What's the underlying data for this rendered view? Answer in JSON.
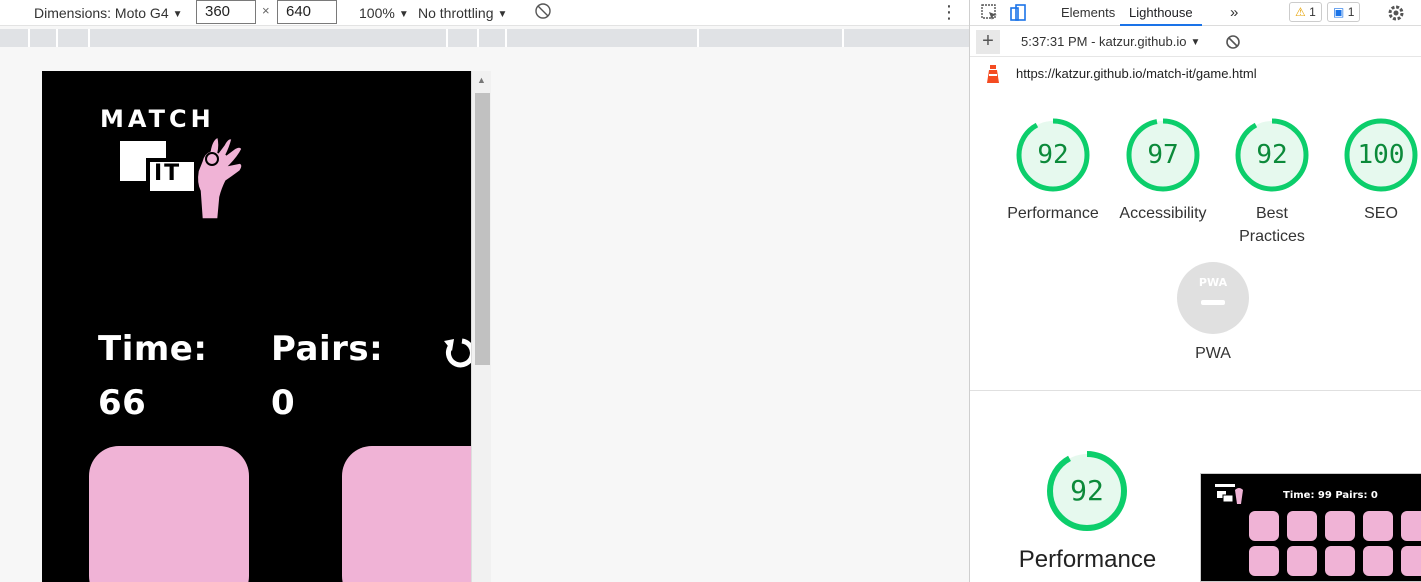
{
  "device_toolbar": {
    "dimensions_label": "Dimensions: Moto G4",
    "width_value": "360",
    "times_symbol": "×",
    "height_value": "640",
    "zoom_label": "100%",
    "throttling_label": "No throttling",
    "more_icon": "kebab-icon",
    "rotate_icon": "rotate-icon"
  },
  "game": {
    "logo_word_match": "MATCH",
    "logo_word_it": "IT",
    "time_label": "Time:",
    "time_value": "66",
    "pairs_label": "Pairs:",
    "pairs_value": "0",
    "restart_icon": "restart-icon",
    "card_color": "#f0b3d6",
    "background_color": "#000000"
  },
  "devtools": {
    "tabs": [
      {
        "label": "Elements"
      },
      {
        "label": "Lighthouse"
      }
    ],
    "warnings_count": "1",
    "messages_count": "1",
    "report_selector": "5:37:31 PM - katzur.github.io",
    "url": "https://katzur.github.io/match-it/game.html",
    "accent_color": "#1a73e8"
  },
  "lighthouse": {
    "scores": [
      {
        "label": "Performance",
        "value": 92
      },
      {
        "label": "Accessibility",
        "value": 97
      },
      {
        "label": "Best Practices",
        "value": 92
      },
      {
        "label": "SEO",
        "value": 100
      }
    ],
    "pwa": {
      "badge_text": "PWA",
      "label": "PWA"
    },
    "detail": {
      "label": "Performance",
      "value": 92
    },
    "pass_color": "#0cce6b",
    "pass_fill": "#e6f9ee"
  },
  "thumbnail": {
    "logo_text": "MATCH IT",
    "stats_text": "Time:  99   Pairs:  0"
  }
}
